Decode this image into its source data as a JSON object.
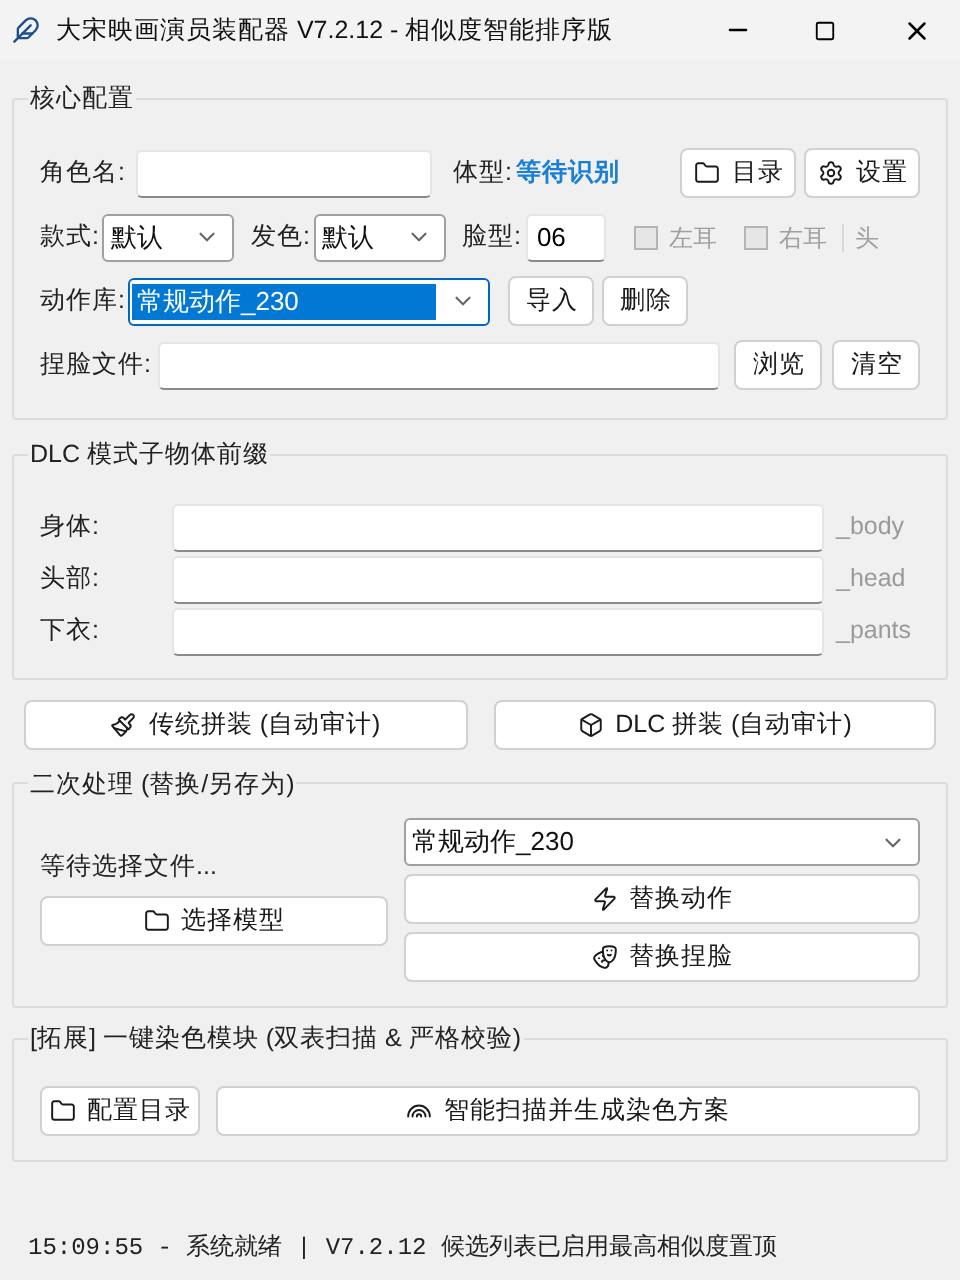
{
  "window": {
    "title": "大宋映画演员装配器 V7.2.12 - 相似度智能排序版"
  },
  "core": {
    "title": "核心配置",
    "name_label": "角色名:",
    "body_type_label": "体型:",
    "body_type_value": "等待识别",
    "buttons": [
      "目录",
      "设置"
    ],
    "style_label": "款式:",
    "style_value": "默认",
    "hair_label": "发色:",
    "hair_value": "默认",
    "face_label": "脸型:",
    "face_value": "06",
    "checks": [
      {
        "label": "左耳",
        "checked": false,
        "disabled": true
      },
      {
        "label": "右耳",
        "checked": false,
        "disabled": true
      }
    ],
    "cut_label": "头",
    "action_label": "动作库:",
    "action_value": "常规动作_230",
    "action_selected": true,
    "action_buttons": [
      "导入",
      "删除"
    ],
    "pinch_label": "捏脸文件:",
    "pinch_buttons": [
      "浏览",
      "清空"
    ]
  },
  "dlc": {
    "title": "DLC 模式子物体前缀",
    "fields": [
      {
        "label": "身体:",
        "suffix": "_body"
      },
      {
        "label": "头部:",
        "suffix": "_head"
      },
      {
        "label": "下衣:",
        "suffix": "_pants"
      }
    ]
  },
  "assemble_buttons": [
    "传统拼装 (自动审计)",
    "DLC 拼装 (自动审计)"
  ],
  "secondary": {
    "title": "二次处理 (替换/另存为)",
    "status": "等待选择文件...",
    "select_button": "选择模型",
    "combo_value": "常规动作_230",
    "buttons": [
      "替换动作",
      "替换捏脸"
    ]
  },
  "dye": {
    "title": "[拓展] 一键染色模块 (双表扫描 & 严格校验)",
    "config_button": "配置目录",
    "scan_button": "智能扫描并生成染色方案"
  },
  "status_bar": "15:09:55 - 系统就绪 | V7.2.12 候选列表已启用最高相似度置顶"
}
